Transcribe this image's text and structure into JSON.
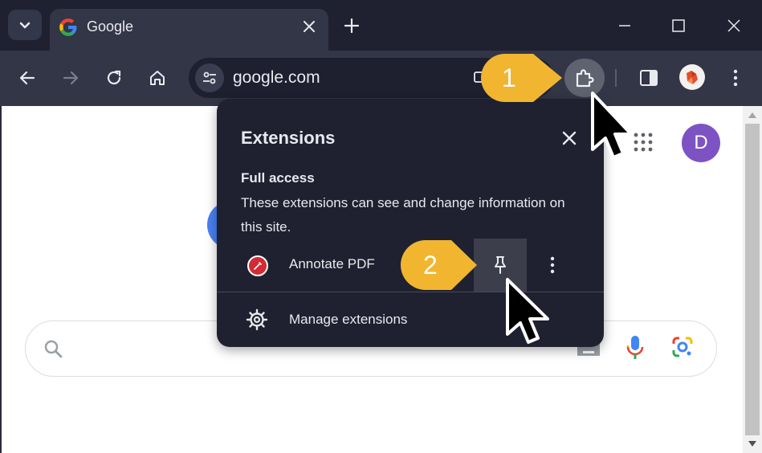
{
  "tab": {
    "title": "Google"
  },
  "omnibox": {
    "url": "google.com"
  },
  "popup": {
    "title": "Extensions",
    "access_heading": "Full access",
    "access_desc": "These extensions can see and change information on this site.",
    "extension_name": "Annotate PDF",
    "manage_label": "Manage extensions"
  },
  "page": {
    "avatar_letter": "D"
  },
  "callouts": {
    "step1": "1",
    "step2": "2"
  },
  "colors": {
    "titlebar": "#1f2130",
    "toolbar": "#333646",
    "callout": "#f1b52f",
    "avatar": "#7d53c4"
  },
  "icons": [
    "tab-search-icon",
    "google-favicon",
    "close-icon",
    "plus-icon",
    "minimize-icon",
    "maximize-icon",
    "back-icon",
    "forward-icon",
    "reload-icon",
    "home-icon",
    "site-info-icon",
    "puzzle-icon",
    "side-panel-icon",
    "kebab-icon",
    "apps-grid-icon",
    "search-icon",
    "keyboard-icon",
    "mic-icon",
    "lens-icon",
    "pin-icon",
    "gear-icon",
    "cursor-icon"
  ]
}
